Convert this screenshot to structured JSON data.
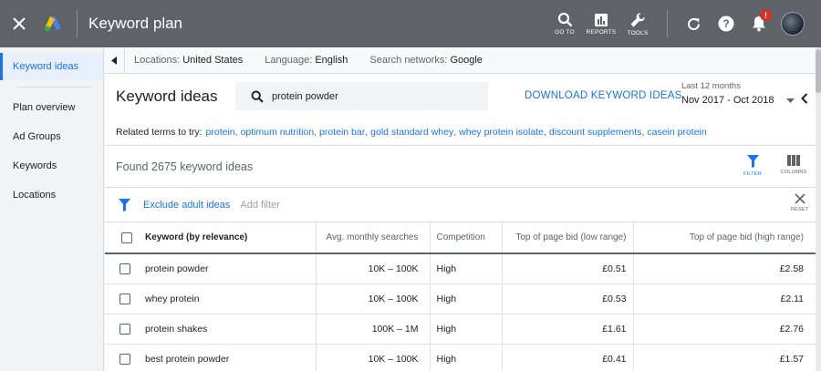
{
  "app": {
    "title": "Keyword plan",
    "tools": [
      {
        "label": "GO TO",
        "icon": "search-icon"
      },
      {
        "label": "REPORTS",
        "icon": "reports-icon"
      },
      {
        "label": "TOOLS",
        "icon": "wrench-icon"
      }
    ],
    "notification_badge": "!",
    "colors": {
      "topbar": "#5f6368",
      "accent": "#1a73e8",
      "badge": "#d93025"
    }
  },
  "sidebar": {
    "items": [
      {
        "label": "Keyword ideas",
        "active": true
      },
      {
        "label": "Plan overview",
        "active": false
      },
      {
        "label": "Ad Groups",
        "active": false
      },
      {
        "label": "Keywords",
        "active": false
      },
      {
        "label": "Locations",
        "active": false
      }
    ]
  },
  "targeting": {
    "locations_key": "Locations:",
    "locations_value": "United States",
    "language_key": "Language:",
    "language_value": "English",
    "networks_key": "Search networks:",
    "networks_value": "Google"
  },
  "header": {
    "title": "Keyword ideas",
    "search_value": "protein powder",
    "download_label": "DOWNLOAD KEYWORD IDEAS",
    "date_caption": "Last 12 months",
    "date_range": "Nov 2017 - Oct 2018"
  },
  "related": {
    "label": "Related terms to try:",
    "terms": [
      "protein",
      "optimum nutrition",
      "protein bar",
      "gold standard whey",
      "whey protein isolate",
      "discount supplements",
      "casein protein"
    ]
  },
  "results": {
    "found_text": "Found 2675 keyword ideas",
    "filter_label": "FILTER",
    "columns_label": "COLUMNS",
    "exclude_label": "Exclude adult ideas",
    "add_filter_label": "Add filter",
    "reset_label": "RESET"
  },
  "table": {
    "headers": {
      "keyword": "Keyword (by relevance)",
      "avg": "Avg. monthly searches",
      "competition": "Competition",
      "low_bid": "Top of page bid (low range)",
      "high_bid": "Top of page bid (high range)"
    },
    "rows": [
      {
        "keyword": "protein powder",
        "avg": "10K – 100K",
        "competition": "High",
        "low_bid": "£0.51",
        "high_bid": "£2.58"
      },
      {
        "keyword": "whey protein",
        "avg": "10K – 100K",
        "competition": "High",
        "low_bid": "£0.53",
        "high_bid": "£2.11"
      },
      {
        "keyword": "protein shakes",
        "avg": "100K – 1M",
        "competition": "High",
        "low_bid": "£1.61",
        "high_bid": "£2.76"
      },
      {
        "keyword": "best protein powder",
        "avg": "10K – 100K",
        "competition": "High",
        "low_bid": "£0.41",
        "high_bid": "£1.57"
      }
    ]
  }
}
